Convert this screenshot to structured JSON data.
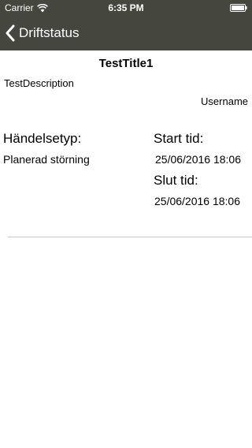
{
  "status_bar": {
    "carrier": "Carrier",
    "time": "6:35 PM",
    "icons": [
      "wifi-icon",
      "battery-icon"
    ]
  },
  "nav_bar": {
    "back_label": "Driftstatus",
    "back_icon": "chevron-left-icon"
  },
  "detail": {
    "title": "TestTitle1",
    "description": "TestDescription",
    "username": "Username",
    "type_label": "Händelsetyp:",
    "type_value": "Planerad störning",
    "start_label": "Start tid:",
    "start_value": "25/06/2016 18:06",
    "end_label": "Slut tid:",
    "end_value": "25/06/2016 18:06"
  },
  "colors": {
    "bar_background": "#45473f",
    "bar_text": "#ffffff",
    "divider": "#c8c8c8"
  }
}
